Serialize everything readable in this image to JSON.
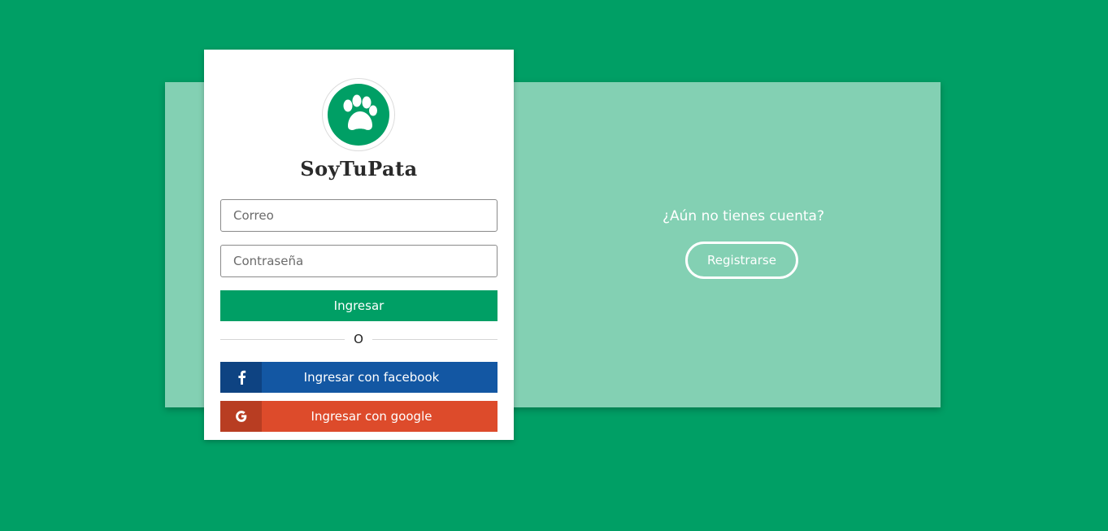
{
  "brand": {
    "name": "SoyTuPata",
    "logo_icon": "paw-icon"
  },
  "login": {
    "email_placeholder": "Correo",
    "password_placeholder": "Contraseña",
    "submit_label": "Ingresar",
    "divider_text": "O",
    "facebook_label": "Ingresar con facebook",
    "facebook_icon": "facebook-icon",
    "google_label": "Ingresar con google",
    "google_icon": "google-icon"
  },
  "signup": {
    "question": "¿Aún no tienes cuenta?",
    "button_label": "Registrarse"
  },
  "colors": {
    "background": "#009f65",
    "panel": "#83d0b3",
    "primary": "#009f65",
    "facebook": "#1357a3",
    "google": "#dd4b2b"
  }
}
